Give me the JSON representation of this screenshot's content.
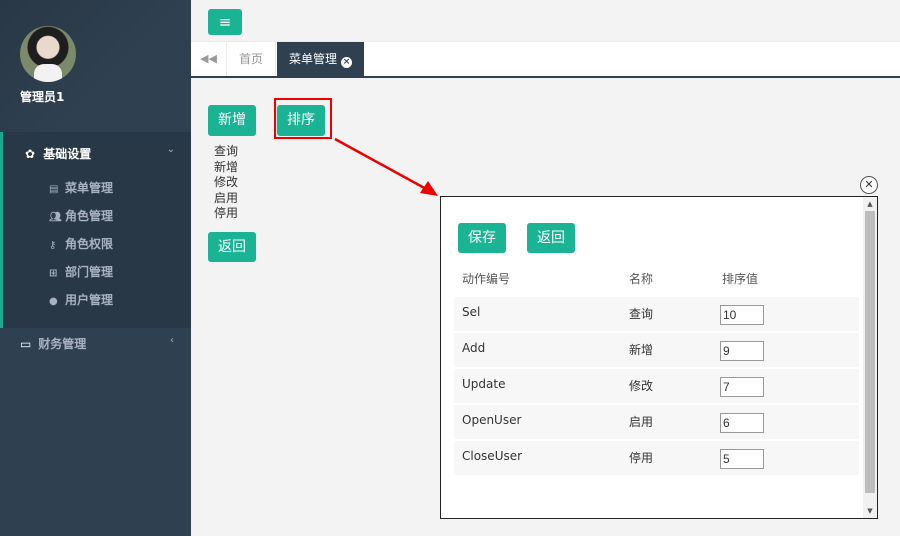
{
  "sidebar": {
    "username": "管理员1",
    "groups": [
      {
        "label": "基础设置",
        "icon": "gear-icon",
        "expanded": true,
        "items": [
          {
            "label": "菜单管理",
            "icon": "list-icon"
          },
          {
            "label": "角色管理",
            "icon": "users-icon"
          },
          {
            "label": "角色权限",
            "icon": "key-icon"
          },
          {
            "label": "部门管理",
            "icon": "sitemap-icon"
          },
          {
            "label": "用户管理",
            "icon": "user-icon"
          }
        ]
      },
      {
        "label": "财务管理",
        "icon": "credit-card-icon",
        "expanded": false
      }
    ]
  },
  "topbar": {
    "menu_icon": "hamburger-icon"
  },
  "tabs": [
    {
      "label": "首页",
      "active": false
    },
    {
      "label": "菜单管理",
      "active": true
    }
  ],
  "main": {
    "add_label": "新增",
    "sort_label": "排序",
    "back_label": "返回",
    "actions": [
      "查询",
      "新增",
      "修改",
      "启用",
      "停用"
    ]
  },
  "modal": {
    "save_label": "保存",
    "back_label": "返回",
    "columns": [
      "动作编号",
      "名称",
      "排序值"
    ],
    "rows": [
      {
        "code": "Sel",
        "name": "查询",
        "order": "10"
      },
      {
        "code": "Add",
        "name": "新增",
        "order": "9"
      },
      {
        "code": "Update",
        "name": "修改",
        "order": "7"
      },
      {
        "code": "OpenUser",
        "name": "启用",
        "order": "6"
      },
      {
        "code": "CloseUser",
        "name": "停用",
        "order": "5"
      }
    ]
  },
  "colors": {
    "accent": "#1ab394",
    "sidebar": "#2f4050",
    "highlight": "#e00000"
  }
}
